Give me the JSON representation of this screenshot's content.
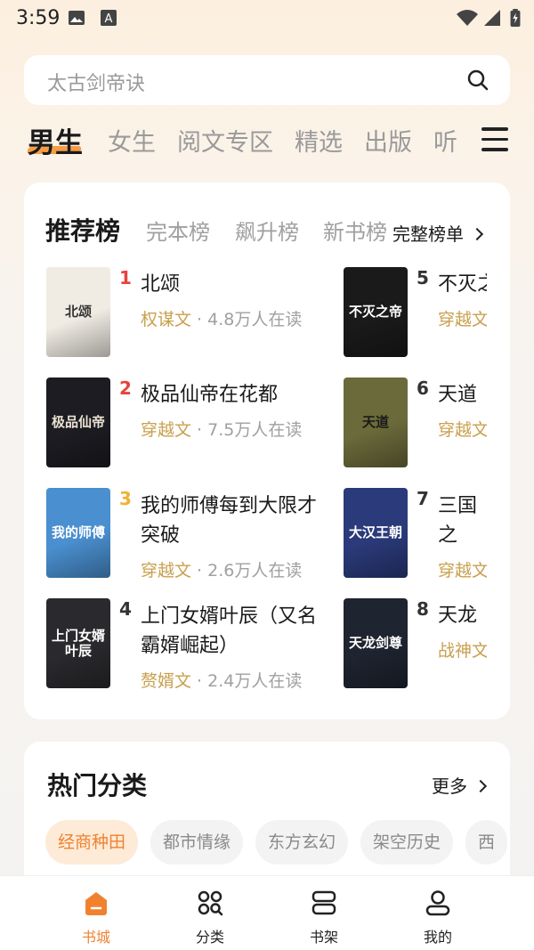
{
  "status_bar": {
    "time": "3:59"
  },
  "search": {
    "placeholder": "太古剑帝诀"
  },
  "category_tabs": [
    {
      "label": "男生",
      "active": true
    },
    {
      "label": "女生"
    },
    {
      "label": "阅文专区"
    },
    {
      "label": "精选"
    },
    {
      "label": "出版"
    },
    {
      "label": "听"
    }
  ],
  "rank": {
    "tabs": [
      {
        "label": "推荐榜",
        "active": true
      },
      {
        "label": "完本榜"
      },
      {
        "label": "飙升榜"
      },
      {
        "label": "新书榜"
      }
    ],
    "full_list_label": "完整榜单",
    "books": [
      {
        "rank": "1",
        "title": "北颂",
        "genre": "权谋文",
        "readers": "4.8万人在读",
        "rank_color": "#e8423a"
      },
      {
        "rank": "2",
        "title": "极品仙帝在花都",
        "genre": "穿越文",
        "readers": "7.5万人在读",
        "rank_color": "#e8423a"
      },
      {
        "rank": "3",
        "title": "我的师傅每到大限才突破",
        "genre": "穿越文",
        "readers": "2.6万人在读",
        "rank_color": "#f2b134"
      },
      {
        "rank": "4",
        "title": "上门女婿叶辰（又名霸婿崛起）",
        "genre": "赘婿文",
        "readers": "2.4万人在读",
        "rank_color": "#333333"
      },
      {
        "rank": "5",
        "title": "不灭之",
        "genre": "穿越文",
        "readers": "",
        "rank_color": "#333333"
      },
      {
        "rank": "6",
        "title": "天道",
        "genre": "穿越文",
        "readers": "",
        "rank_color": "#333333"
      },
      {
        "rank": "7",
        "title": "三国之备，",
        "genre": "穿越文",
        "readers": "",
        "rank_color": "#333333"
      },
      {
        "rank": "8",
        "title": "天龙",
        "genre": "战神文",
        "readers": "",
        "rank_color": "#333333"
      }
    ],
    "covers": [
      {
        "text": "北颂",
        "bg": "#f0ece4",
        "fg": "#333333"
      },
      {
        "text": "极品仙帝",
        "bg": "#1c1c22",
        "fg": "#e8e0d0"
      },
      {
        "text": "我的师傅",
        "bg": "#4a8fcf",
        "fg": "#ffffff"
      },
      {
        "text": "上门女婿叶辰",
        "bg": "#2a2a2e",
        "fg": "#ffffff"
      },
      {
        "text": "不灭之帝",
        "bg": "#1a1a1a",
        "fg": "#ffffff"
      },
      {
        "text": "天道",
        "bg": "#6b6a3a",
        "fg": "#1a1a1a"
      },
      {
        "text": "大汉王朝",
        "bg": "#2b3a7a",
        "fg": "#ffffff"
      },
      {
        "text": "天龙剑尊",
        "bg": "#1e2430",
        "fg": "#ffffff"
      }
    ]
  },
  "hot_categories": {
    "title": "热门分类",
    "more_label": "更多",
    "chips": [
      "经商种田",
      "都市情缘",
      "东方玄幻",
      "架空历史",
      "西"
    ]
  },
  "bottom_nav": [
    {
      "label": "书城",
      "icon": "home-icon",
      "active": true
    },
    {
      "label": "分类",
      "icon": "category-grid-icon"
    },
    {
      "label": "书架",
      "icon": "bookshelf-icon"
    },
    {
      "label": "我的",
      "icon": "profile-icon"
    }
  ],
  "colors": {
    "accent": "#f0822f",
    "genre": "#c8a04e"
  }
}
